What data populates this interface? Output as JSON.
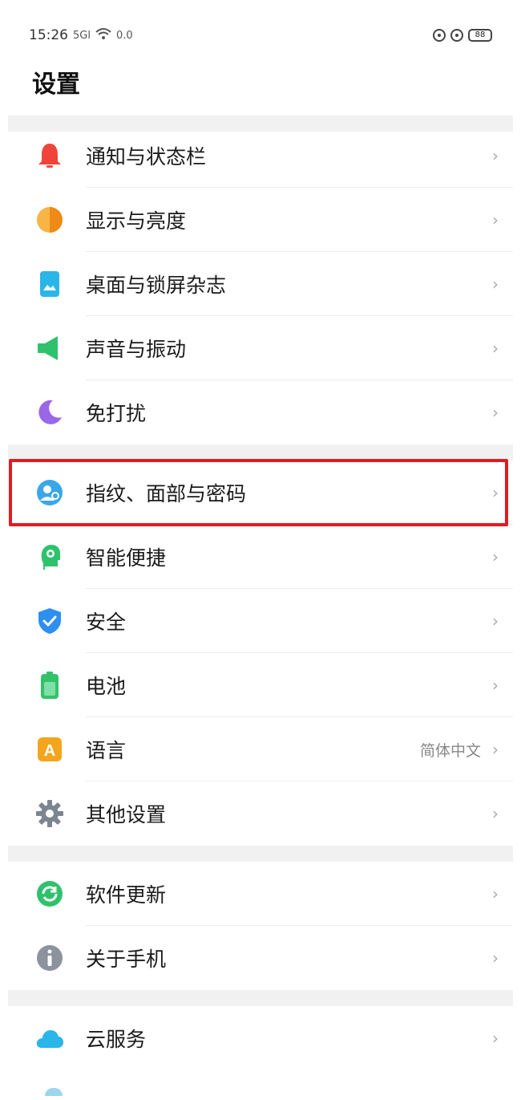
{
  "status_bar": {
    "time": "15:26",
    "signal": "5Gl",
    "network_speed": "0.0",
    "battery": "88"
  },
  "page": {
    "title": "设置"
  },
  "settings_items": [
    {
      "label": "通知与状态栏",
      "icon": "bell-icon",
      "color": "#f0443a"
    },
    {
      "label": "显示与亮度",
      "icon": "brightness-icon",
      "color": "#f39a1e"
    },
    {
      "label": "桌面与锁屏杂志",
      "icon": "wallpaper-icon",
      "color": "#2ab6e8"
    },
    {
      "label": "声音与振动",
      "icon": "speaker-icon",
      "color": "#2ec26c"
    },
    {
      "label": "免打扰",
      "icon": "moon-icon",
      "color": "#9a67e8"
    },
    {
      "label": "指纹、面部与密码",
      "icon": "face-fingerprint-icon",
      "color": "#3aa7ea"
    },
    {
      "label": "智能便捷",
      "icon": "smart-head-icon",
      "color": "#2ec26c"
    },
    {
      "label": "安全",
      "icon": "shield-icon",
      "color": "#2d8ff0"
    },
    {
      "label": "电池",
      "icon": "battery-icon",
      "color": "#33c26c"
    },
    {
      "label": "语言",
      "icon": "language-icon",
      "color": "#f3a51e",
      "value": "简体中文",
      "glyph": "A"
    },
    {
      "label": "其他设置",
      "icon": "gear-icon",
      "color": "#7c8590"
    },
    {
      "label": "软件更新",
      "icon": "update-icon",
      "color": "#2ec26c"
    },
    {
      "label": "关于手机",
      "icon": "info-icon",
      "color": "#8c939c"
    },
    {
      "label": "云服务",
      "icon": "cloud-icon",
      "color": "#2ab6e8"
    }
  ],
  "colors": {
    "highlight_border": "#e11b22",
    "section_gap": "#f1f1f1"
  }
}
